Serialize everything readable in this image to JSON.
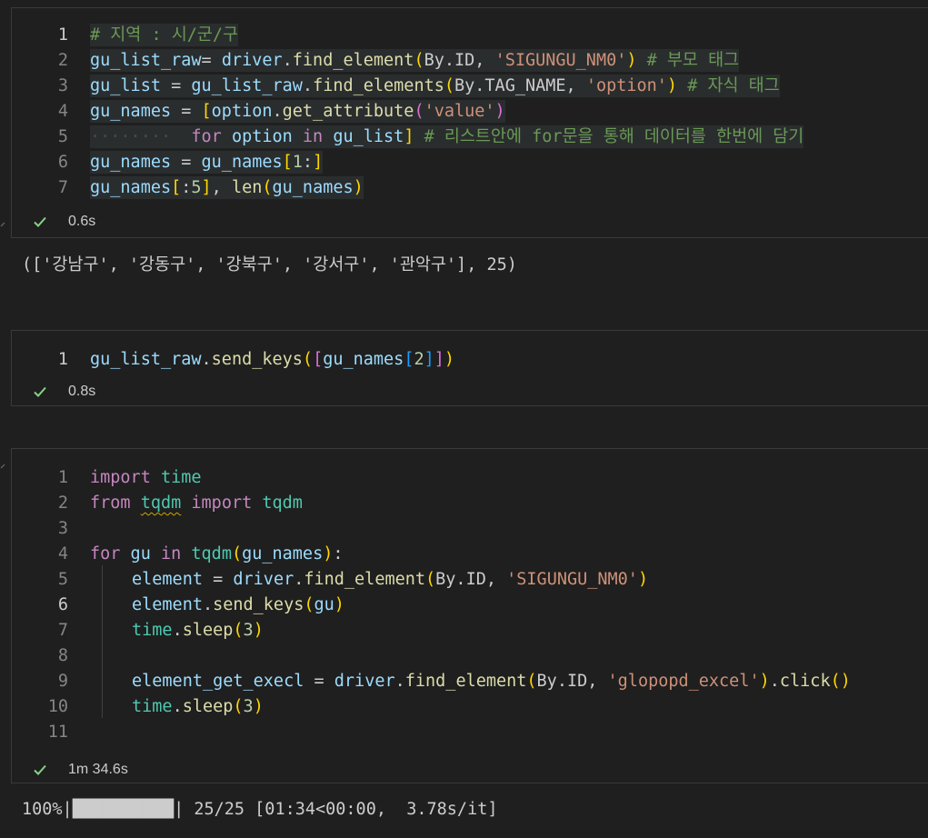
{
  "cells": [
    {
      "line_numbers": [
        "1",
        "2",
        "3",
        "4",
        "5",
        "6",
        "7"
      ],
      "status": "0.6s",
      "output": "(['강남구', '강동구', '강북구', '강서구', '관악구'], 25)"
    },
    {
      "line_numbers": [
        "1"
      ],
      "status": "0.8s"
    },
    {
      "line_numbers": [
        "1",
        "2",
        "3",
        "4",
        "5",
        "6",
        "7",
        "8",
        "9",
        "10",
        "11"
      ],
      "status": "1m 34.6s",
      "output": "100%|██████████| 25/25 [01:34<00:00,  3.78s/it]"
    }
  ],
  "tokens": {
    "c1": {
      "l1_comment": "# 지역 : 시/군/구",
      "l2_var": "gu_list_raw",
      "l2_eq": "= ",
      "l2_driver": "driver",
      "l2_dot": ".",
      "l2_fn": "find_element",
      "l2_open": "(",
      "l2_by": "By.ID",
      "l2_comma": ", ",
      "l2_str": "'SIGUNGU_NM0'",
      "l2_close": ")",
      "l2_comment": " # 부모 태그",
      "l3_var": "gu_list",
      "l3_eq": " = ",
      "l3_obj": "gu_list_raw",
      "l3_dot": ".",
      "l3_fn": "find_elements",
      "l3_open": "(",
      "l3_by": "By.TAG_NAME",
      "l3_comma": ", ",
      "l3_str": "'option'",
      "l3_close": ")",
      "l3_comment": " # 자식 태그",
      "l4_var": "gu_names",
      "l4_eq": " = ",
      "l4_open": "[",
      "l4_obj": "option",
      "l4_dot": ".",
      "l4_fn": "get_attribute",
      "l4_popen": "(",
      "l4_str": "'value'",
      "l4_pclose": ")",
      "l5_indent": "········",
      "l5_for": "for",
      "l5_sp1": " ",
      "l5_var": "option",
      "l5_sp2": " ",
      "l5_in": "in",
      "l5_sp3": " ",
      "l5_list": "gu_list",
      "l5_close": "]",
      "l5_comment": " # 리스트안에 for문을 통해 데이터를 한번에 담기",
      "l6_var": "gu_names",
      "l6_eq": " = ",
      "l6_obj": "gu_names",
      "l6_open": "[",
      "l6_num": "1",
      "l6_colon": ":",
      "l6_close": "]",
      "l7_var": "gu_names",
      "l7_open": "[",
      "l7_colon": ":",
      "l7_num": "5",
      "l7_close": "]",
      "l7_comma": ", ",
      "l7_fn": "len",
      "l7_popen": "(",
      "l7_arg": "gu_names",
      "l7_pclose": ")"
    },
    "c2": {
      "l1_obj": "gu_list_raw",
      "l1_dot": ".",
      "l1_fn": "send_keys",
      "l1_popen": "(",
      "l1_bopen": "[",
      "l1_var": "gu_names",
      "l1_iopen": "[",
      "l1_num": "2",
      "l1_iclose": "]",
      "l1_bclose": "]",
      "l1_pclose": ")"
    },
    "c3": {
      "l1_import": "import",
      "l1_mod": " time",
      "l2_from": "from",
      "l2_sp": " ",
      "l2_mod": "tqdm",
      "l2_import": " import",
      "l2_name": " tqdm",
      "l4_for": "for",
      "l4_var": " gu",
      "l4_in": " in",
      "l4_fn": " tqdm",
      "l4_open": "(",
      "l4_arg": "gu_names",
      "l4_close": ")",
      "l4_colon": ":",
      "l5_var": "element",
      "l5_eq": " = ",
      "l5_driver": "driver",
      "l5_dot": ".",
      "l5_fn": "find_element",
      "l5_open": "(",
      "l5_by": "By.ID",
      "l5_comma": ", ",
      "l5_str": "'SIGUNGU_NM0'",
      "l5_close": ")",
      "l6_var": "element",
      "l6_dot": ".",
      "l6_fn": "send_keys",
      "l6_open": "(",
      "l6_arg": "gu",
      "l6_close": ")",
      "l7_mod": "time",
      "l7_dot": ".",
      "l7_fn": "sleep",
      "l7_open": "(",
      "l7_num": "3",
      "l7_close": ")",
      "l9_var": "element_get_execl",
      "l9_eq": " = ",
      "l9_driver": "driver",
      "l9_dot": ".",
      "l9_fn": "find_element",
      "l9_open": "(",
      "l9_by": "By.ID",
      "l9_comma": ", ",
      "l9_str": "'glopopd_excel'",
      "l9_close": ")",
      "l9_dot2": ".",
      "l9_fn2": "click",
      "l9_call": "()",
      "l10_mod": "time",
      "l10_dot": ".",
      "l10_fn": "sleep",
      "l10_open": "(",
      "l10_num": "3",
      "l10_close": ")"
    }
  },
  "icons": {
    "status_icon": "checkmark-icon"
  },
  "colors": {
    "keyword": "#c586c0",
    "function": "#dcdcaa",
    "variable": "#9cdcfe",
    "string": "#ce9178",
    "number": "#b5cea8",
    "comment": "#6a9955",
    "module": "#4ec9b0",
    "success": "#89d185"
  }
}
